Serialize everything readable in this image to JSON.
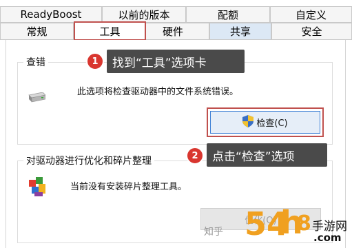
{
  "tabs_row1": [
    {
      "label": "ReadyBoost"
    },
    {
      "label": "以前的版本"
    },
    {
      "label": "配额"
    },
    {
      "label": "自定义"
    }
  ],
  "tabs_row2": [
    {
      "label": "常规"
    },
    {
      "label": "工具"
    },
    {
      "label": "硬件"
    },
    {
      "label": "共享"
    },
    {
      "label": "安全"
    }
  ],
  "check_group": {
    "title": "查错",
    "description": "此选项将检查驱动器中的文件系统错误。",
    "button_label": "检查(C)"
  },
  "optimize_group": {
    "title": "对驱动器进行优化和碎片整理",
    "description": "当前没有安装碎片整理工具。",
    "button_label": "优化(O)"
  },
  "callouts": [
    {
      "number": "1",
      "text": "找到“工具”选项卡"
    },
    {
      "number": "2",
      "text": "点击“检查”选项"
    }
  ],
  "watermarks": {
    "zhihu": "知乎",
    "brand_number": "54",
    "brand_letter": "h",
    "brand_extra": "8",
    "site_name": "手游网",
    "domain": ".com"
  },
  "colors": {
    "highlight_frame": "#c0504d",
    "callout_bg": "#4a4a4a",
    "badge_red": "#d9362f",
    "watermark_orange": "#f0a020"
  }
}
